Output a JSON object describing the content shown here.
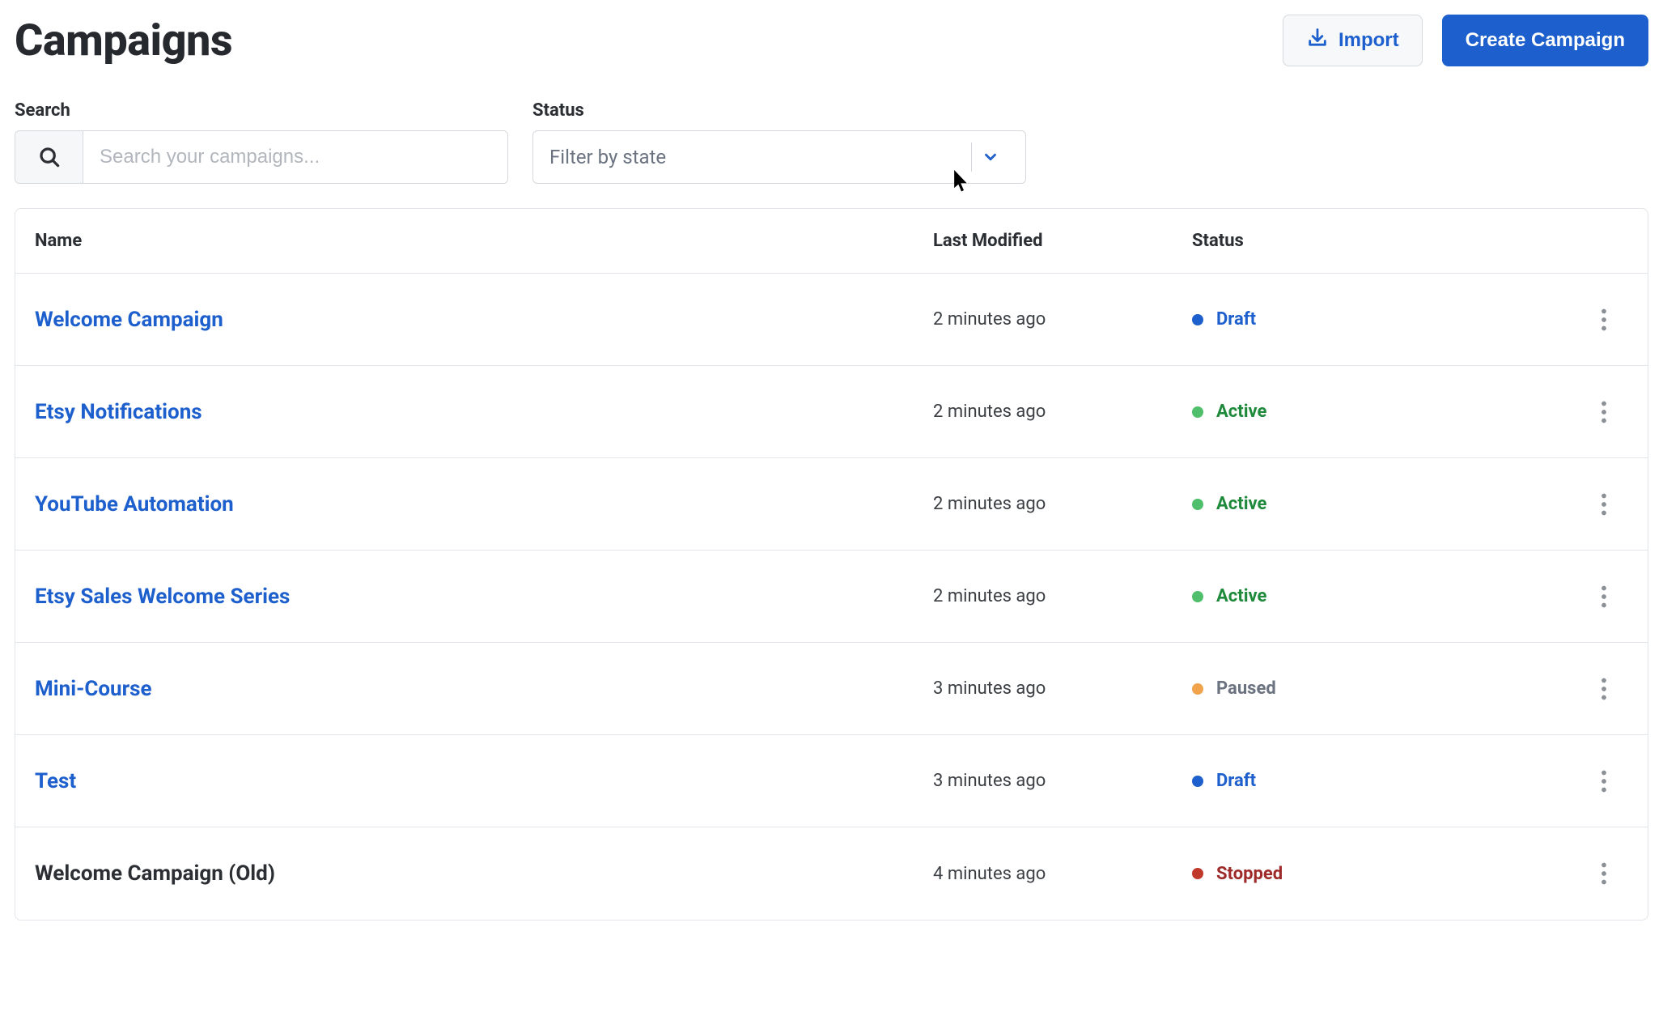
{
  "header": {
    "title": "Campaigns",
    "import_label": "Import",
    "create_label": "Create Campaign"
  },
  "filters": {
    "search_label": "Search",
    "search_placeholder": "Search your campaigns...",
    "status_label": "Status",
    "status_placeholder": "Filter by state"
  },
  "table": {
    "columns": {
      "name": "Name",
      "modified": "Last Modified",
      "status": "Status"
    },
    "rows": [
      {
        "name": "Welcome Campaign",
        "modified": "2 minutes ago",
        "status": "Draft",
        "status_color": "#1d5fcc",
        "name_muted": false
      },
      {
        "name": "Etsy Notifications",
        "modified": "2 minutes ago",
        "status": "Active",
        "status_color": "#1f8a3b",
        "name_muted": false
      },
      {
        "name": "YouTube Automation",
        "modified": "2 minutes ago",
        "status": "Active",
        "status_color": "#1f8a3b",
        "name_muted": false
      },
      {
        "name": "Etsy Sales Welcome Series",
        "modified": "2 minutes ago",
        "status": "Active",
        "status_color": "#1f8a3b",
        "name_muted": false
      },
      {
        "name": "Mini-Course",
        "modified": "3 minutes ago",
        "status": "Paused",
        "status_color": "#6b7280",
        "name_muted": false
      },
      {
        "name": "Test",
        "modified": "3 minutes ago",
        "status": "Draft",
        "status_color": "#1d5fcc",
        "name_muted": false
      },
      {
        "name": "Welcome Campaign (Old)",
        "modified": "4 minutes ago",
        "status": "Stopped",
        "status_color": "#9e2a2a",
        "name_muted": true
      }
    ]
  },
  "status_dot_colors": {
    "Draft": "#1d5fcc",
    "Active": "#4fbf6b",
    "Paused": "#f0a34a",
    "Stopped": "#c0392b"
  }
}
